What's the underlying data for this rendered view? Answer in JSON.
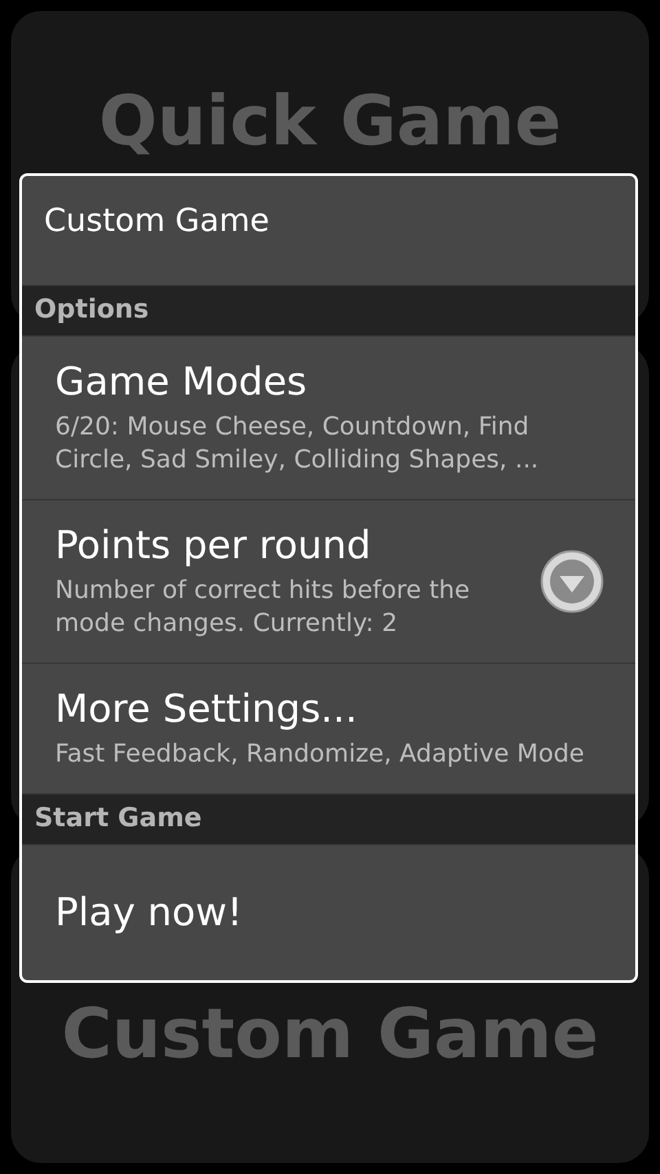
{
  "background": {
    "cards": [
      {
        "title": "Quick Game"
      },
      {
        "title": "Custom Game"
      }
    ]
  },
  "dialog": {
    "title": "Custom Game",
    "sections": [
      {
        "header": "Options",
        "items": [
          {
            "kind": "text",
            "title": "Game Modes",
            "summary": "6/20: Mouse Cheese, Countdown, Find Circle, Sad Smiley, Colliding Shapes, ..."
          },
          {
            "kind": "list",
            "title": "Points per round",
            "summary": "Number of correct hits before the mode changes. Currently: 2"
          },
          {
            "kind": "text",
            "title": "More Settings...",
            "summary": "Fast Feedback, Randomize, Adaptive Mode"
          }
        ]
      },
      {
        "header": "Start Game",
        "items": [
          {
            "kind": "action",
            "title": "Play now!"
          }
        ]
      }
    ]
  }
}
